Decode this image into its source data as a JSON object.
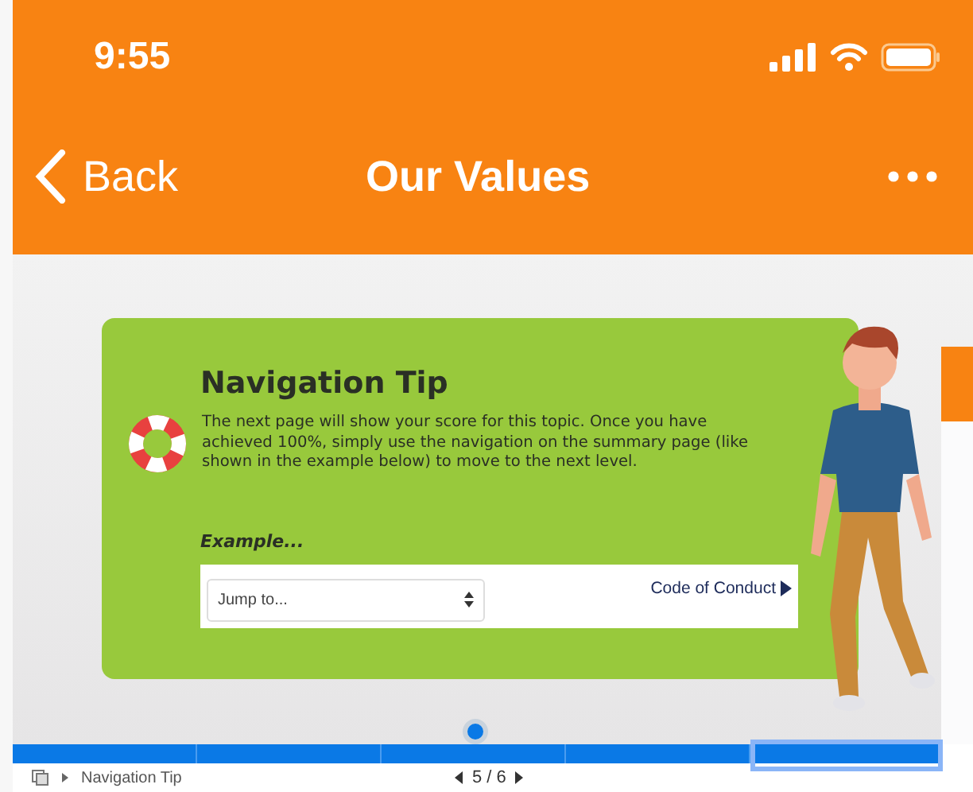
{
  "status_bar": {
    "time": "9:55"
  },
  "nav_bar": {
    "back": "Back",
    "title": "Our Values"
  },
  "card": {
    "title": "Navigation Tip",
    "body": "The next page will show your score for this topic. Once you have achieved 100%, simply use the navigation on the summary page (like shown in the example below) to move to the next level.",
    "example_label": "Example...",
    "example": {
      "select_value": "Jump to...",
      "link": "Code of Conduct"
    }
  },
  "progress": {
    "level": 0.5,
    "segments": [
      {
        "selected": false
      },
      {
        "selected": false
      },
      {
        "selected": false
      },
      {
        "selected": false
      },
      {
        "selected": true
      }
    ]
  },
  "footer": {
    "breadcrumb": "Navigation Tip",
    "page": "5 / 6"
  }
}
